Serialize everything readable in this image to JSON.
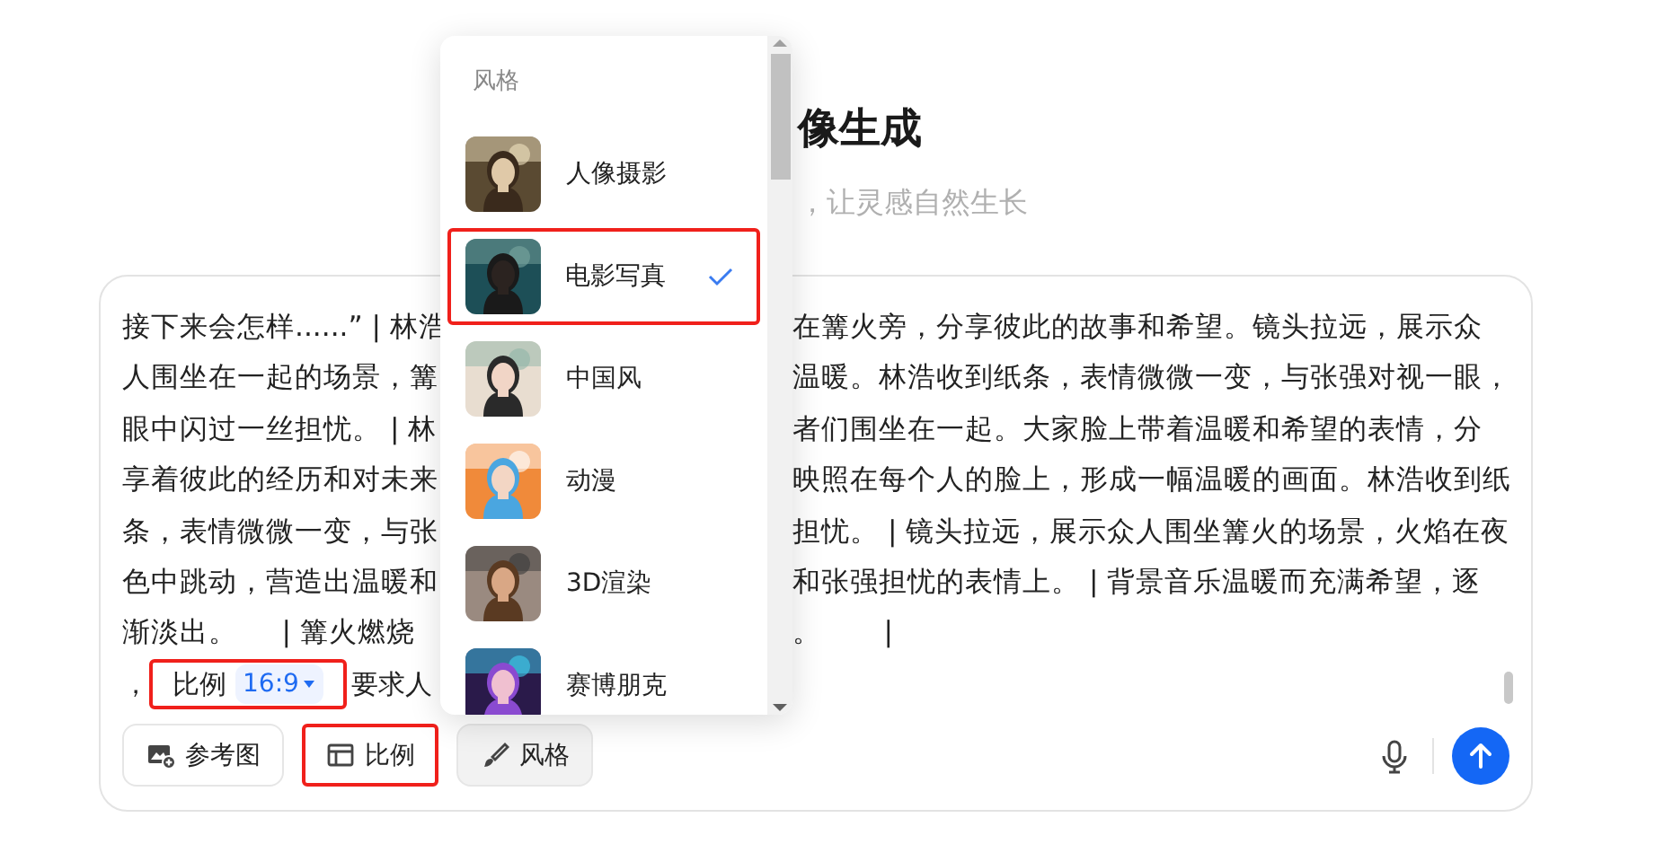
{
  "header": {
    "title": "像生成",
    "subtitle": "，让灵感自然生长"
  },
  "prompt": {
    "lines": [
      {
        "left": "接下来会怎样......” | 林浩",
        "right": "在篝火旁，分享彼此的故事和希望。镜头拉远，展示众"
      },
      {
        "left": "人围坐在一起的场景，篝",
        "right": "温暖。林浩收到纸条，表情微微一变，与张强对视一眼，"
      },
      {
        "left": "眼中闪过一丝担忧。 | 林",
        "right": "者们围坐在一起。大家脸上带着温暖和希望的表情，分"
      },
      {
        "left": "享着彼此的经历和对未来",
        "right": "映照在每个人的脸上，形成一幅温暖的画面。林浩收到纸"
      },
      {
        "left": "条，表情微微一变，与张",
        "right": "担忧。 | 镜头拉远，展示众人围坐篝火的场景，火焰在夜"
      },
      {
        "left": "色中跳动，营造出温暖和",
        "right": "和张强担忧的表情上。 | 背景音乐温暖而充满希望，逐"
      },
      {
        "left": "渐淡出。     | 篝火燃烧",
        "right": "。       |"
      }
    ],
    "last_line": {
      "prefix": "，",
      "chip": {
        "label": "比例",
        "value": "16:9",
        "highlighted": true
      },
      "suffix": "要求人"
    }
  },
  "toolbar": {
    "buttons": [
      {
        "kind": "reference",
        "label": "参考图",
        "selected": false,
        "highlighted": false
      },
      {
        "kind": "ratio",
        "label": "比例",
        "selected": false,
        "highlighted": true
      },
      {
        "kind": "style",
        "label": "风格",
        "selected": true,
        "highlighted": false
      }
    ]
  },
  "style_menu": {
    "title": "风格",
    "items": [
      {
        "label": "人像摄影",
        "selected": false,
        "highlighted": false
      },
      {
        "label": "电影写真",
        "selected": true,
        "highlighted": true
      },
      {
        "label": "中国风",
        "selected": false,
        "highlighted": false
      },
      {
        "label": "动漫",
        "selected": false,
        "highlighted": false
      },
      {
        "label": "3D渲染",
        "selected": false,
        "highlighted": false
      },
      {
        "label": "赛博朋克",
        "selected": false,
        "highlighted": false
      }
    ]
  }
}
